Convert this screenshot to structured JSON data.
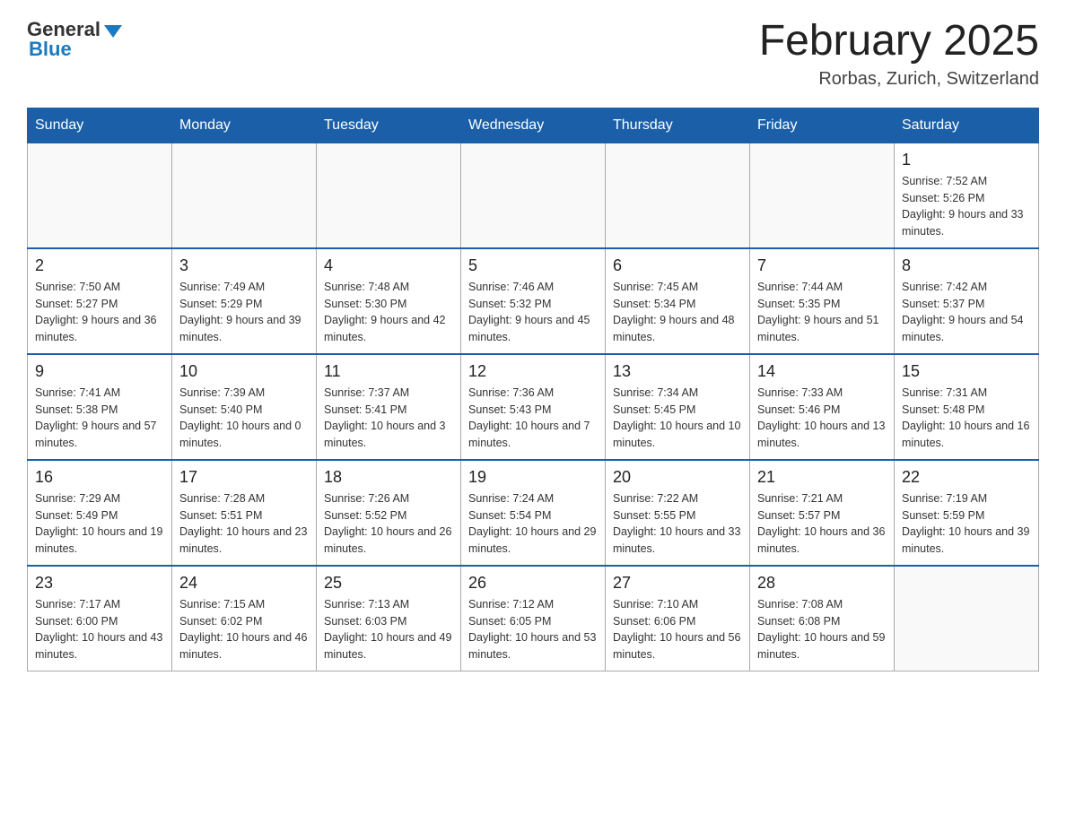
{
  "header": {
    "logo_general": "General",
    "logo_blue": "Blue",
    "month_title": "February 2025",
    "location": "Rorbas, Zurich, Switzerland"
  },
  "days_of_week": [
    "Sunday",
    "Monday",
    "Tuesday",
    "Wednesday",
    "Thursday",
    "Friday",
    "Saturday"
  ],
  "weeks": [
    [
      {
        "day": "",
        "info": ""
      },
      {
        "day": "",
        "info": ""
      },
      {
        "day": "",
        "info": ""
      },
      {
        "day": "",
        "info": ""
      },
      {
        "day": "",
        "info": ""
      },
      {
        "day": "",
        "info": ""
      },
      {
        "day": "1",
        "info": "Sunrise: 7:52 AM\nSunset: 5:26 PM\nDaylight: 9 hours and 33 minutes."
      }
    ],
    [
      {
        "day": "2",
        "info": "Sunrise: 7:50 AM\nSunset: 5:27 PM\nDaylight: 9 hours and 36 minutes."
      },
      {
        "day": "3",
        "info": "Sunrise: 7:49 AM\nSunset: 5:29 PM\nDaylight: 9 hours and 39 minutes."
      },
      {
        "day": "4",
        "info": "Sunrise: 7:48 AM\nSunset: 5:30 PM\nDaylight: 9 hours and 42 minutes."
      },
      {
        "day": "5",
        "info": "Sunrise: 7:46 AM\nSunset: 5:32 PM\nDaylight: 9 hours and 45 minutes."
      },
      {
        "day": "6",
        "info": "Sunrise: 7:45 AM\nSunset: 5:34 PM\nDaylight: 9 hours and 48 minutes."
      },
      {
        "day": "7",
        "info": "Sunrise: 7:44 AM\nSunset: 5:35 PM\nDaylight: 9 hours and 51 minutes."
      },
      {
        "day": "8",
        "info": "Sunrise: 7:42 AM\nSunset: 5:37 PM\nDaylight: 9 hours and 54 minutes."
      }
    ],
    [
      {
        "day": "9",
        "info": "Sunrise: 7:41 AM\nSunset: 5:38 PM\nDaylight: 9 hours and 57 minutes."
      },
      {
        "day": "10",
        "info": "Sunrise: 7:39 AM\nSunset: 5:40 PM\nDaylight: 10 hours and 0 minutes."
      },
      {
        "day": "11",
        "info": "Sunrise: 7:37 AM\nSunset: 5:41 PM\nDaylight: 10 hours and 3 minutes."
      },
      {
        "day": "12",
        "info": "Sunrise: 7:36 AM\nSunset: 5:43 PM\nDaylight: 10 hours and 7 minutes."
      },
      {
        "day": "13",
        "info": "Sunrise: 7:34 AM\nSunset: 5:45 PM\nDaylight: 10 hours and 10 minutes."
      },
      {
        "day": "14",
        "info": "Sunrise: 7:33 AM\nSunset: 5:46 PM\nDaylight: 10 hours and 13 minutes."
      },
      {
        "day": "15",
        "info": "Sunrise: 7:31 AM\nSunset: 5:48 PM\nDaylight: 10 hours and 16 minutes."
      }
    ],
    [
      {
        "day": "16",
        "info": "Sunrise: 7:29 AM\nSunset: 5:49 PM\nDaylight: 10 hours and 19 minutes."
      },
      {
        "day": "17",
        "info": "Sunrise: 7:28 AM\nSunset: 5:51 PM\nDaylight: 10 hours and 23 minutes."
      },
      {
        "day": "18",
        "info": "Sunrise: 7:26 AM\nSunset: 5:52 PM\nDaylight: 10 hours and 26 minutes."
      },
      {
        "day": "19",
        "info": "Sunrise: 7:24 AM\nSunset: 5:54 PM\nDaylight: 10 hours and 29 minutes."
      },
      {
        "day": "20",
        "info": "Sunrise: 7:22 AM\nSunset: 5:55 PM\nDaylight: 10 hours and 33 minutes."
      },
      {
        "day": "21",
        "info": "Sunrise: 7:21 AM\nSunset: 5:57 PM\nDaylight: 10 hours and 36 minutes."
      },
      {
        "day": "22",
        "info": "Sunrise: 7:19 AM\nSunset: 5:59 PM\nDaylight: 10 hours and 39 minutes."
      }
    ],
    [
      {
        "day": "23",
        "info": "Sunrise: 7:17 AM\nSunset: 6:00 PM\nDaylight: 10 hours and 43 minutes."
      },
      {
        "day": "24",
        "info": "Sunrise: 7:15 AM\nSunset: 6:02 PM\nDaylight: 10 hours and 46 minutes."
      },
      {
        "day": "25",
        "info": "Sunrise: 7:13 AM\nSunset: 6:03 PM\nDaylight: 10 hours and 49 minutes."
      },
      {
        "day": "26",
        "info": "Sunrise: 7:12 AM\nSunset: 6:05 PM\nDaylight: 10 hours and 53 minutes."
      },
      {
        "day": "27",
        "info": "Sunrise: 7:10 AM\nSunset: 6:06 PM\nDaylight: 10 hours and 56 minutes."
      },
      {
        "day": "28",
        "info": "Sunrise: 7:08 AM\nSunset: 6:08 PM\nDaylight: 10 hours and 59 minutes."
      },
      {
        "day": "",
        "info": ""
      }
    ]
  ]
}
